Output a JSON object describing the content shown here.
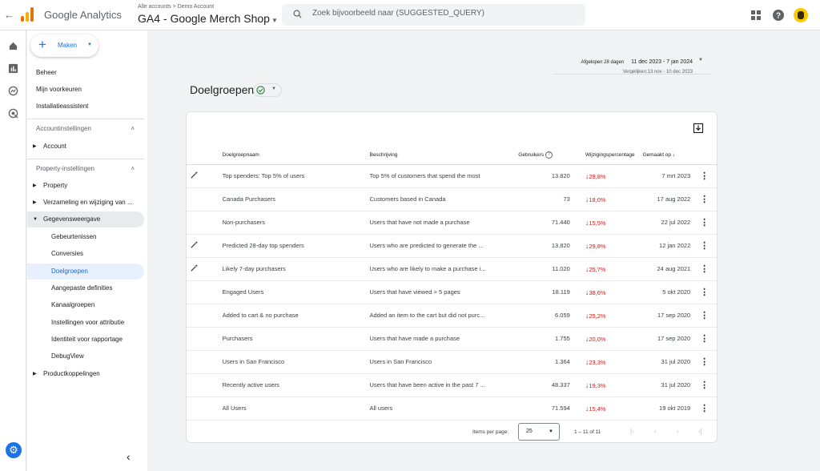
{
  "header": {
    "product_name": "Google Analytics",
    "breadcrumb": "Alle accounts > Demo Account",
    "property_name": "GA4 - Google Merch Shop",
    "search_placeholder": "Zoek bijvoorbeeld naar (SUGGESTED_QUERY)"
  },
  "sidebar": {
    "create_label": "Maken",
    "items": [
      {
        "label": "Beheer"
      },
      {
        "label": "Mijn voorkeuren"
      },
      {
        "label": "Installatieassistent"
      }
    ],
    "account_section": "Accountinstellingen",
    "account_items": [
      {
        "label": "Account"
      }
    ],
    "property_section": "Property-instellingen",
    "property_items": [
      {
        "label": "Property"
      },
      {
        "label": "Verzameling en wijziging van ..."
      },
      {
        "label": "Gegevensweergave"
      }
    ],
    "data_display_items": [
      {
        "label": "Gebeurtenissen"
      },
      {
        "label": "Conversies"
      },
      {
        "label": "Doelgroepen"
      },
      {
        "label": "Aangepaste definities"
      },
      {
        "label": "Kanaalgroepen"
      },
      {
        "label": "Instellingen voor attributie"
      },
      {
        "label": "Identiteit voor rapportage"
      },
      {
        "label": "DebugView"
      }
    ],
    "bottom_item": "Productkoppelingen"
  },
  "date_range": {
    "label": "Afgelopen 28 dagen",
    "range": "11 dec 2023 - 7 jan 2024",
    "compare": "Vergelijken:13 nov - 10 dec 2023"
  },
  "page_title": "Doelgroepen",
  "table": {
    "headers": {
      "name": "Doelgroepnaam",
      "description": "Beschrijving",
      "users": "Gebruikers",
      "change": "Wijzigingspercentage",
      "created": "Gemaakt op"
    },
    "rows": [
      {
        "name": "Top spenders: Top 5% of users",
        "description": "Top 5% of customers that spend the most",
        "users": "13.820",
        "change": "29,8%",
        "created": "7 mrt 2023"
      },
      {
        "name": "Canada Purchasers",
        "description": "Customers based in Canada",
        "users": "73",
        "change": "18,0%",
        "created": "17 aug 2022"
      },
      {
        "name": "Non-purchasers",
        "description": "Users that have not made a purchase",
        "users": "71.440",
        "change": "15,5%",
        "created": "22 jul 2022"
      },
      {
        "name": "Predicted 28-day top spenders",
        "description": "Users who are predicted to generate the ...",
        "users": "13.820",
        "change": "29,8%",
        "created": "12 jan 2022"
      },
      {
        "name": "Likely 7-day purchasers",
        "description": "Users who are likely to make a purchase i...",
        "users": "11.020",
        "change": "25,7%",
        "created": "24 aug 2021"
      },
      {
        "name": "Engaged Users",
        "description": "Users that have viewed > 5 pages",
        "users": "18.119",
        "change": "38,6%",
        "created": "5 okt 2020"
      },
      {
        "name": "Added to cart & no purchase",
        "description": "Added an item to the cart but did not purc...",
        "users": "6.059",
        "change": "25,2%",
        "created": "17 sep 2020"
      },
      {
        "name": "Purchasers",
        "description": "Users that have made a purchase",
        "users": "1.755",
        "change": "20,0%",
        "created": "17 sep 2020"
      },
      {
        "name": "Users in San Francisco",
        "description": "Users in San Francisco",
        "users": "1.364",
        "change": "23,3%",
        "created": "31 jul 2020"
      },
      {
        "name": "Recently active users",
        "description": "Users that have been active in the past 7 ...",
        "users": "48.337",
        "change": "19,3%",
        "created": "31 jul 2020"
      },
      {
        "name": "All Users",
        "description": "All users",
        "users": "71.594",
        "change": "15,4%",
        "created": "19 okt 2019"
      }
    ]
  },
  "pagination": {
    "items_per_page_label": "Items per page:",
    "items_per_page": "25",
    "range": "1 – 11 of 11"
  },
  "colors": {
    "accent": "#1a73e8",
    "negative": "#c5221f",
    "active_bg": "#e8f0fe"
  }
}
